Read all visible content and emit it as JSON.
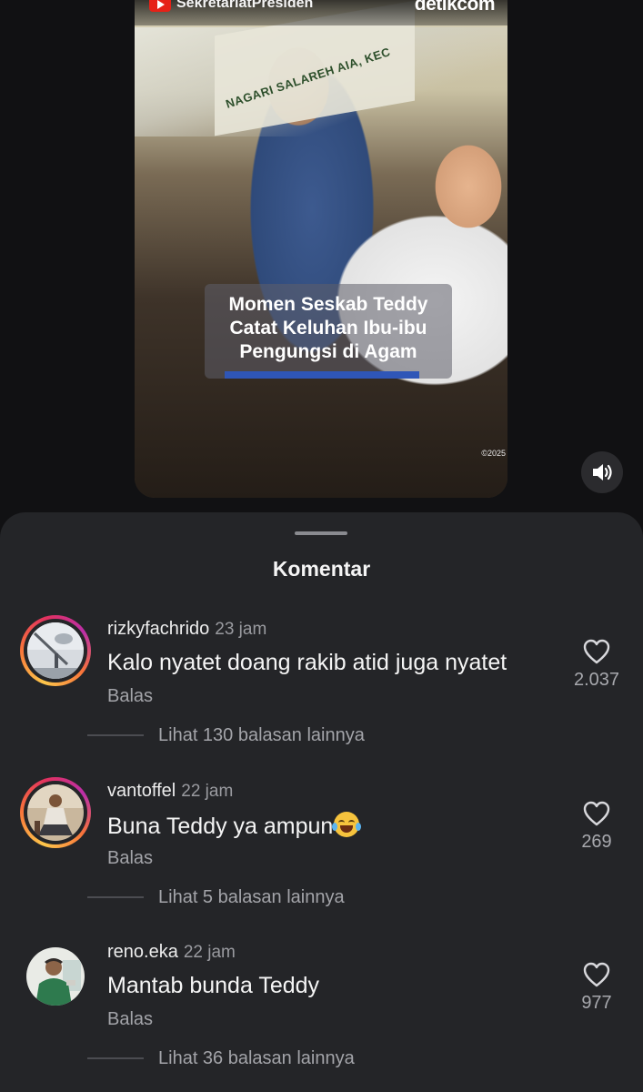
{
  "video": {
    "channel_name": "SekretariatPresiden",
    "brand": "detikcom",
    "banner_text": "NAGARI SALAREH AIA, KEC",
    "caption_lines": [
      "Momen Seskab Teddy",
      "Catat Keluhan Ibu-ibu",
      "Pengungsi di Agam"
    ],
    "copyright": "©2025",
    "mute_icon": "speaker-icon"
  },
  "sheet": {
    "title": "Komentar"
  },
  "comments": [
    {
      "username": "rizkyfachrido",
      "time": "23 jam",
      "text": "Kalo nyatet doang rakib atid juga nyatet",
      "reply_label": "Balas",
      "likes": "2.037",
      "replies_label": "Lihat 130 balasan lainnya",
      "has_story_ring": true
    },
    {
      "username": "vantoffel",
      "time": "22 jam",
      "text": "Buna Teddy ya ampun",
      "emoji": "face-with-tears-of-joy",
      "reply_label": "Balas",
      "likes": "269",
      "replies_label": "Lihat 5 balasan lainnya",
      "has_story_ring": true
    },
    {
      "username": "reno.eka",
      "time": "22 jam",
      "text": "Mantab bunda Teddy",
      "reply_label": "Balas",
      "likes": "977",
      "replies_label": "Lihat 36 balasan lainnya",
      "has_story_ring": false
    }
  ],
  "colors": {
    "background": "#111113",
    "sheet": "#242528",
    "caption_bar": "#2f56b7",
    "muted_text": "#a3a4a9"
  }
}
